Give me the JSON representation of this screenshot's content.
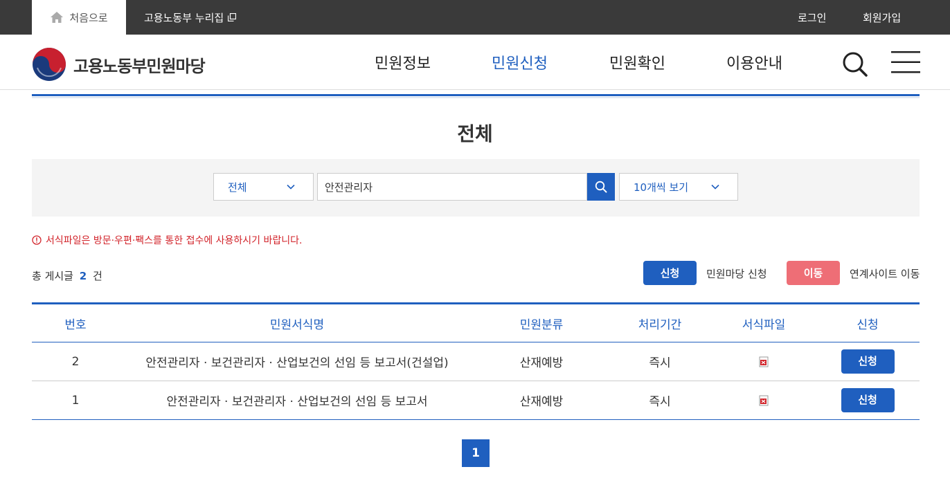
{
  "topbar": {
    "home_label": "처음으로",
    "nuri_label": "고용노동부 누리집",
    "login_label": "로그인",
    "signup_label": "회원가입"
  },
  "header": {
    "logo_text": "고용노동부민원마당",
    "nav": [
      {
        "label": "민원정보",
        "active": false
      },
      {
        "label": "민원신청",
        "active": true
      },
      {
        "label": "민원확인",
        "active": false
      },
      {
        "label": "이용안내",
        "active": false
      }
    ]
  },
  "page": {
    "title": "전체"
  },
  "search": {
    "category_value": "전체",
    "keyword_value": "안전관리자",
    "count_value": "10개씩 보기"
  },
  "notice": "서식파일은 방문·우편·팩스를 통한 접수에 사용하시기 바랍니다.",
  "summary": {
    "prefix": "총 게시글",
    "count": "2",
    "suffix": "건"
  },
  "legend": {
    "apply_btn": "신청",
    "apply_desc": "민원마당 신청",
    "move_btn": "이동",
    "move_desc": "연계사이트 이동"
  },
  "table": {
    "headers": [
      "번호",
      "민원서식명",
      "민원분류",
      "처리기간",
      "서식파일",
      "신청"
    ],
    "rows": [
      {
        "no": "2",
        "name": "안전관리자 · 보건관리자 · 산업보건의 선임 등 보고서(건설업)",
        "category": "산재예방",
        "period": "즉시",
        "apply": "신청"
      },
      {
        "no": "1",
        "name": "안전관리자 · 보건관리자 · 산업보건의 선임 등 보고서",
        "category": "산재예방",
        "period": "즉시",
        "apply": "신청"
      }
    ]
  },
  "pagination": {
    "current": "1"
  },
  "colors": {
    "primary": "#1f5fbf",
    "danger": "#d2232a",
    "move": "#ee6e76",
    "topbar": "#3a3a3a"
  }
}
